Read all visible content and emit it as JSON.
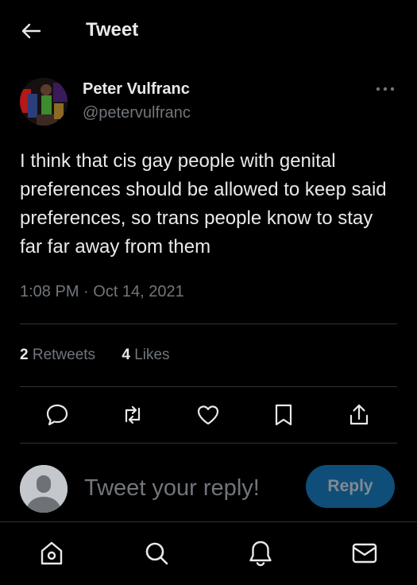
{
  "header": {
    "title": "Tweet",
    "back_icon": "arrow-left-icon"
  },
  "author": {
    "name": "Peter Vulfranc",
    "handle": "@petervulfranc"
  },
  "tweet": {
    "text": "I think that cis gay people with genital preferences should be allowed to keep said preferences, so trans people know to stay far far away from them",
    "timestamp": "1:08 PM · Oct 14, 2021"
  },
  "stats": {
    "retweets_count": "2",
    "retweets_label": "Retweets",
    "likes_count": "4",
    "likes_label": "Likes"
  },
  "actions": [
    "reply-icon",
    "retweet-icon",
    "like-icon",
    "bookmark-icon",
    "share-icon"
  ],
  "reply": {
    "placeholder": "Tweet your reply!",
    "button_label": "Reply"
  },
  "nav": [
    "home-icon",
    "search-icon",
    "notifications-icon",
    "messages-icon"
  ],
  "colors": {
    "background": "#000000",
    "text": "#e7e9ea",
    "secondary_text": "#71767b",
    "divider": "#2f3336",
    "reply_button": "#0f4e78"
  }
}
